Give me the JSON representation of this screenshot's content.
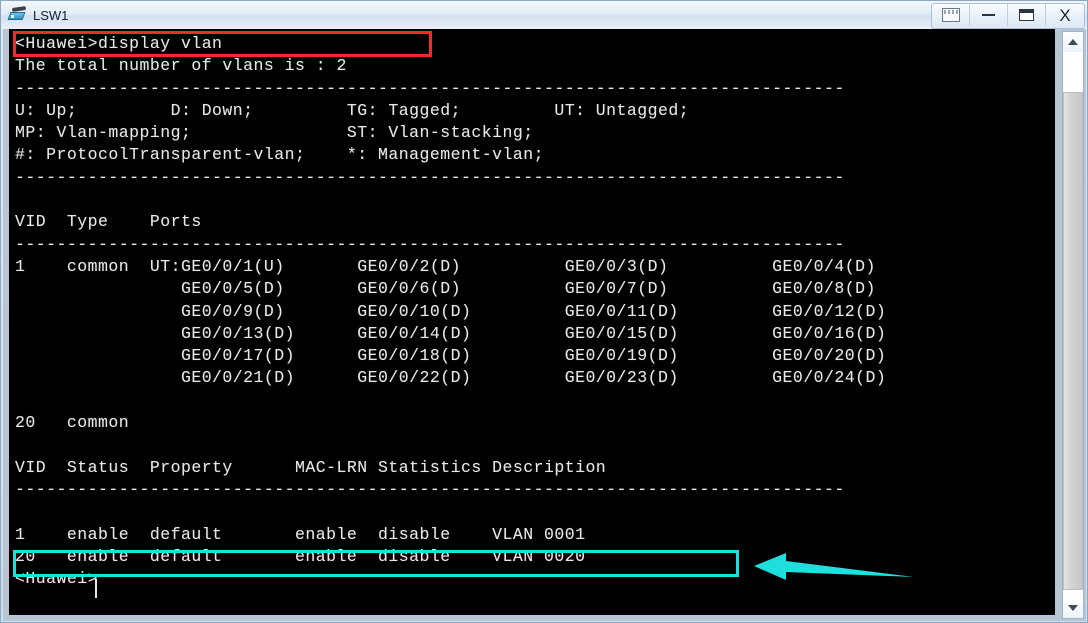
{
  "window": {
    "title": "LSW1",
    "device_icon": "switch-icon",
    "controls": {
      "restore_window_label": "restore-window",
      "minimize_label": "minimize",
      "maximize_label": "maximize",
      "close_label": "X"
    }
  },
  "colors": {
    "terminal_background": "#000000",
    "terminal_text": "#e8e8e8",
    "highlight_red": "#ef2b2b",
    "highlight_cyan": "#1fdede",
    "titlebar": "#e3edf7"
  },
  "terminal": {
    "command": "<Huawei>display vlan",
    "prompt": "<Huawei>",
    "content": "<Huawei>display vlan\nThe total number of vlans is : 2\n--------------------------------------------------------------------------------\nU: Up;         D: Down;         TG: Tagged;         UT: Untagged;\nMP: Vlan-mapping;               ST: Vlan-stacking;\n#: ProtocolTransparent-vlan;    *: Management-vlan;\n--------------------------------------------------------------------------------\n\nVID  Type    Ports\n--------------------------------------------------------------------------------\n1    common  UT:GE0/0/1(U)       GE0/0/2(D)          GE0/0/3(D)          GE0/0/4(D)\n                GE0/0/5(D)       GE0/0/6(D)          GE0/0/7(D)          GE0/0/8(D)\n                GE0/0/9(D)       GE0/0/10(D)         GE0/0/11(D)         GE0/0/12(D)\n                GE0/0/13(D)      GE0/0/14(D)         GE0/0/15(D)         GE0/0/16(D)\n                GE0/0/17(D)      GE0/0/18(D)         GE0/0/19(D)         GE0/0/20(D)\n                GE0/0/21(D)      GE0/0/22(D)         GE0/0/23(D)         GE0/0/24(D)\n\n20   common\n\nVID  Status  Property      MAC-LRN Statistics Description\n--------------------------------------------------------------------------------\n\n1    enable  default       enable  disable    VLAN 0001\n20   enable  default       enable  disable    VLAN 0020\n<Huawei>",
    "total_vlans_line": "The total number of vlans is : 2",
    "separator": "--------------------------------------------------------------------------------",
    "legend": [
      {
        "col1": "U: Up;",
        "col2": "D: Down;",
        "col3": "TG: Tagged;",
        "col4": "UT: Untagged;"
      },
      {
        "col1": "MP: Vlan-mapping;",
        "col2": "",
        "col3": "ST: Vlan-stacking;",
        "col4": ""
      },
      {
        "col1": "#: ProtocolTransparent-vlan;",
        "col2": "",
        "col3": "*: Management-vlan;",
        "col4": ""
      }
    ],
    "ports_table": {
      "headers": [
        "VID",
        "Type",
        "Ports"
      ],
      "rows": [
        {
          "vid": "1",
          "type": "common",
          "tag_prefix": "UT:",
          "port_rows": [
            [
              "GE0/0/1(U)",
              "GE0/0/2(D)",
              "GE0/0/3(D)",
              "GE0/0/4(D)"
            ],
            [
              "GE0/0/5(D)",
              "GE0/0/6(D)",
              "GE0/0/7(D)",
              "GE0/0/8(D)"
            ],
            [
              "GE0/0/9(D)",
              "GE0/0/10(D)",
              "GE0/0/11(D)",
              "GE0/0/12(D)"
            ],
            [
              "GE0/0/13(D)",
              "GE0/0/14(D)",
              "GE0/0/15(D)",
              "GE0/0/16(D)"
            ],
            [
              "GE0/0/17(D)",
              "GE0/0/18(D)",
              "GE0/0/19(D)",
              "GE0/0/20(D)"
            ],
            [
              "GE0/0/21(D)",
              "GE0/0/22(D)",
              "GE0/0/23(D)",
              "GE0/0/24(D)"
            ]
          ]
        },
        {
          "vid": "20",
          "type": "common",
          "tag_prefix": "",
          "port_rows": []
        }
      ]
    },
    "status_table": {
      "headers": [
        "VID",
        "Status",
        "Property",
        "MAC-LRN",
        "Statistics",
        "Description"
      ],
      "rows": [
        {
          "vid": "1",
          "status": "enable",
          "property": "default",
          "mac_lrn": "enable",
          "statistics": "disable",
          "description": "VLAN 0001"
        },
        {
          "vid": "20",
          "status": "enable",
          "property": "default",
          "mac_lrn": "enable",
          "statistics": "disable",
          "description": "VLAN 0020"
        }
      ]
    }
  },
  "annotations": {
    "red_box_target": "<Huawei>display vlan",
    "cyan_box_target": "20   enable  default       enable  disable    VLAN 0020",
    "arrow_direction": "left"
  },
  "scrollbar": {
    "up_arrow": "scroll-up",
    "down_arrow": "scroll-down",
    "position": "near-bottom"
  }
}
